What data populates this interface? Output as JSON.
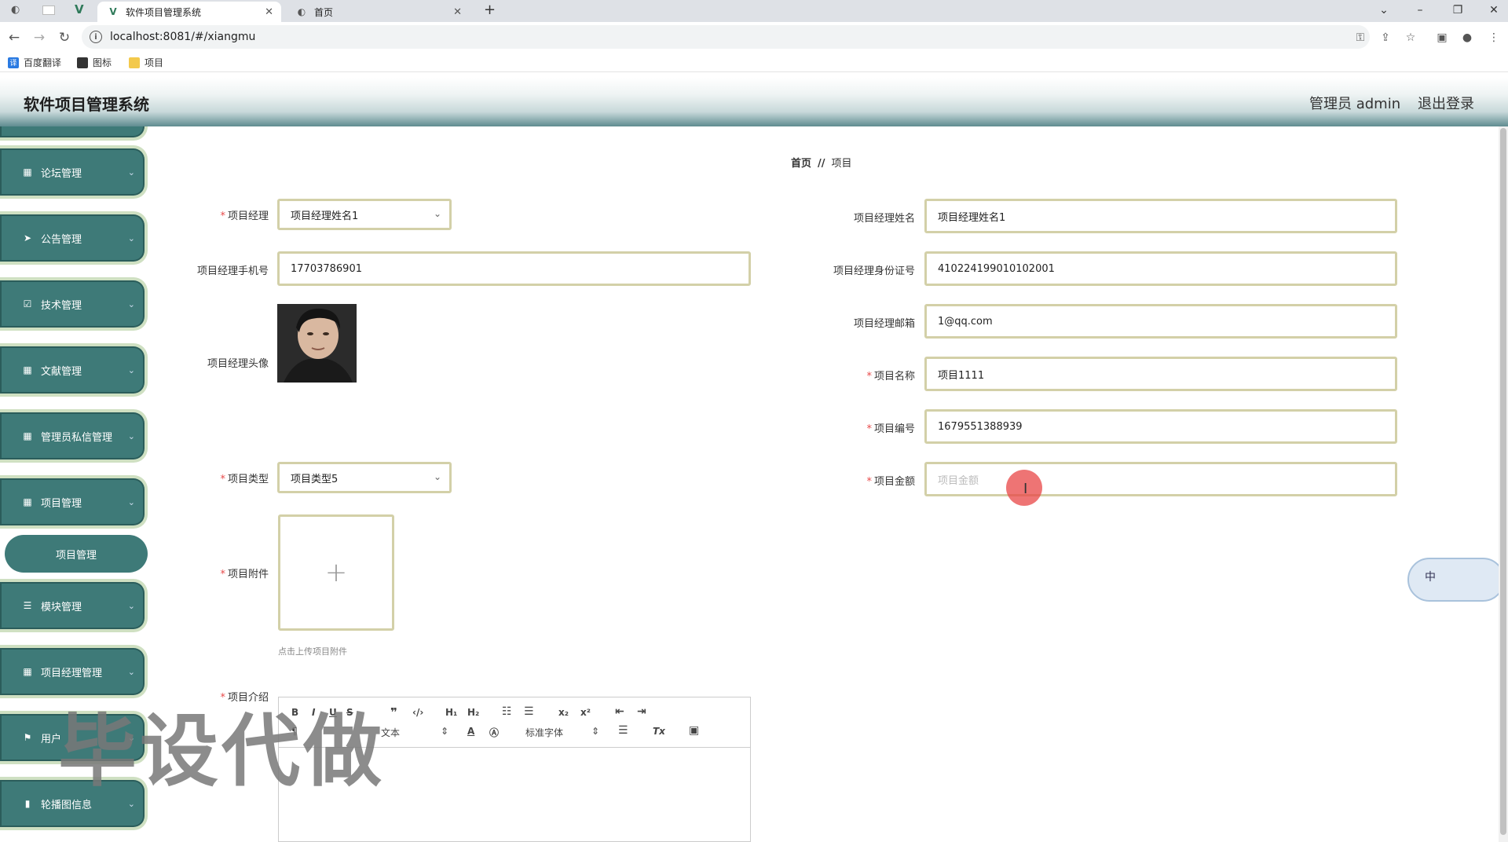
{
  "browser": {
    "tabs": [
      {
        "label": "软件项目管理系统",
        "active": true
      },
      {
        "label": "首页",
        "active": false
      }
    ],
    "new_tab": "+",
    "url": "localhost:8081/#/xiangmu",
    "bookmarks": [
      "百度翻译",
      "图标",
      "项目"
    ]
  },
  "header": {
    "title": "软件项目管理系统",
    "admin": "管理员 admin",
    "logout": "退出登录"
  },
  "sidebar": {
    "items": [
      {
        "label": "论坛管理",
        "icon": "grid-icon"
      },
      {
        "label": "公告管理",
        "icon": "send-icon"
      },
      {
        "label": "技术管理",
        "icon": "check-square-icon"
      },
      {
        "label": "文献管理",
        "icon": "grid-icon"
      },
      {
        "label": "管理员私信管理",
        "icon": "grid-icon"
      },
      {
        "label": "项目管理",
        "icon": "grid-icon"
      },
      {
        "label": "模块管理",
        "icon": "sliders-icon"
      },
      {
        "label": "项目经理管理",
        "icon": "grid-icon"
      },
      {
        "label": "用户",
        "icon": "flag-icon"
      },
      {
        "label": "轮播图信息",
        "icon": "image-icon"
      }
    ],
    "sub_item": "项目管理"
  },
  "breadcrumb": {
    "home": "首页",
    "separator": "//",
    "current": "项目"
  },
  "form": {
    "manager_label": "项目经理",
    "manager_value": "项目经理姓名1",
    "phone_label": "项目经理手机号",
    "phone_value": "17703786901",
    "avatar_label": "项目经理头像",
    "type_label": "项目类型",
    "type_value": "项目类型5",
    "attachment_label": "项目附件",
    "attachment_plus": "+",
    "attachment_hint": "点击上传项目附件",
    "intro_label": "项目介绍",
    "manager_name_label": "项目经理姓名",
    "manager_name_value": "项目经理姓名1",
    "id_label": "项目经理身份证号",
    "id_value": "410224199010102001",
    "email_label": "项目经理邮箱",
    "email_value": "1@qq.com",
    "name_label": "项目名称",
    "name_value": "项目1111",
    "number_label": "项目编号",
    "number_value": "1679551388939",
    "amount_label": "项目金额",
    "amount_placeholder": "项目金额"
  },
  "editor": {
    "format_select": "文本",
    "font_select": "标准字体"
  },
  "ime": {
    "label": "中"
  },
  "watermark": "毕设代做",
  "colors": {
    "sidebar": "#3e7a78",
    "field_border": "#d3d0a8",
    "required": "#e84a4a"
  }
}
